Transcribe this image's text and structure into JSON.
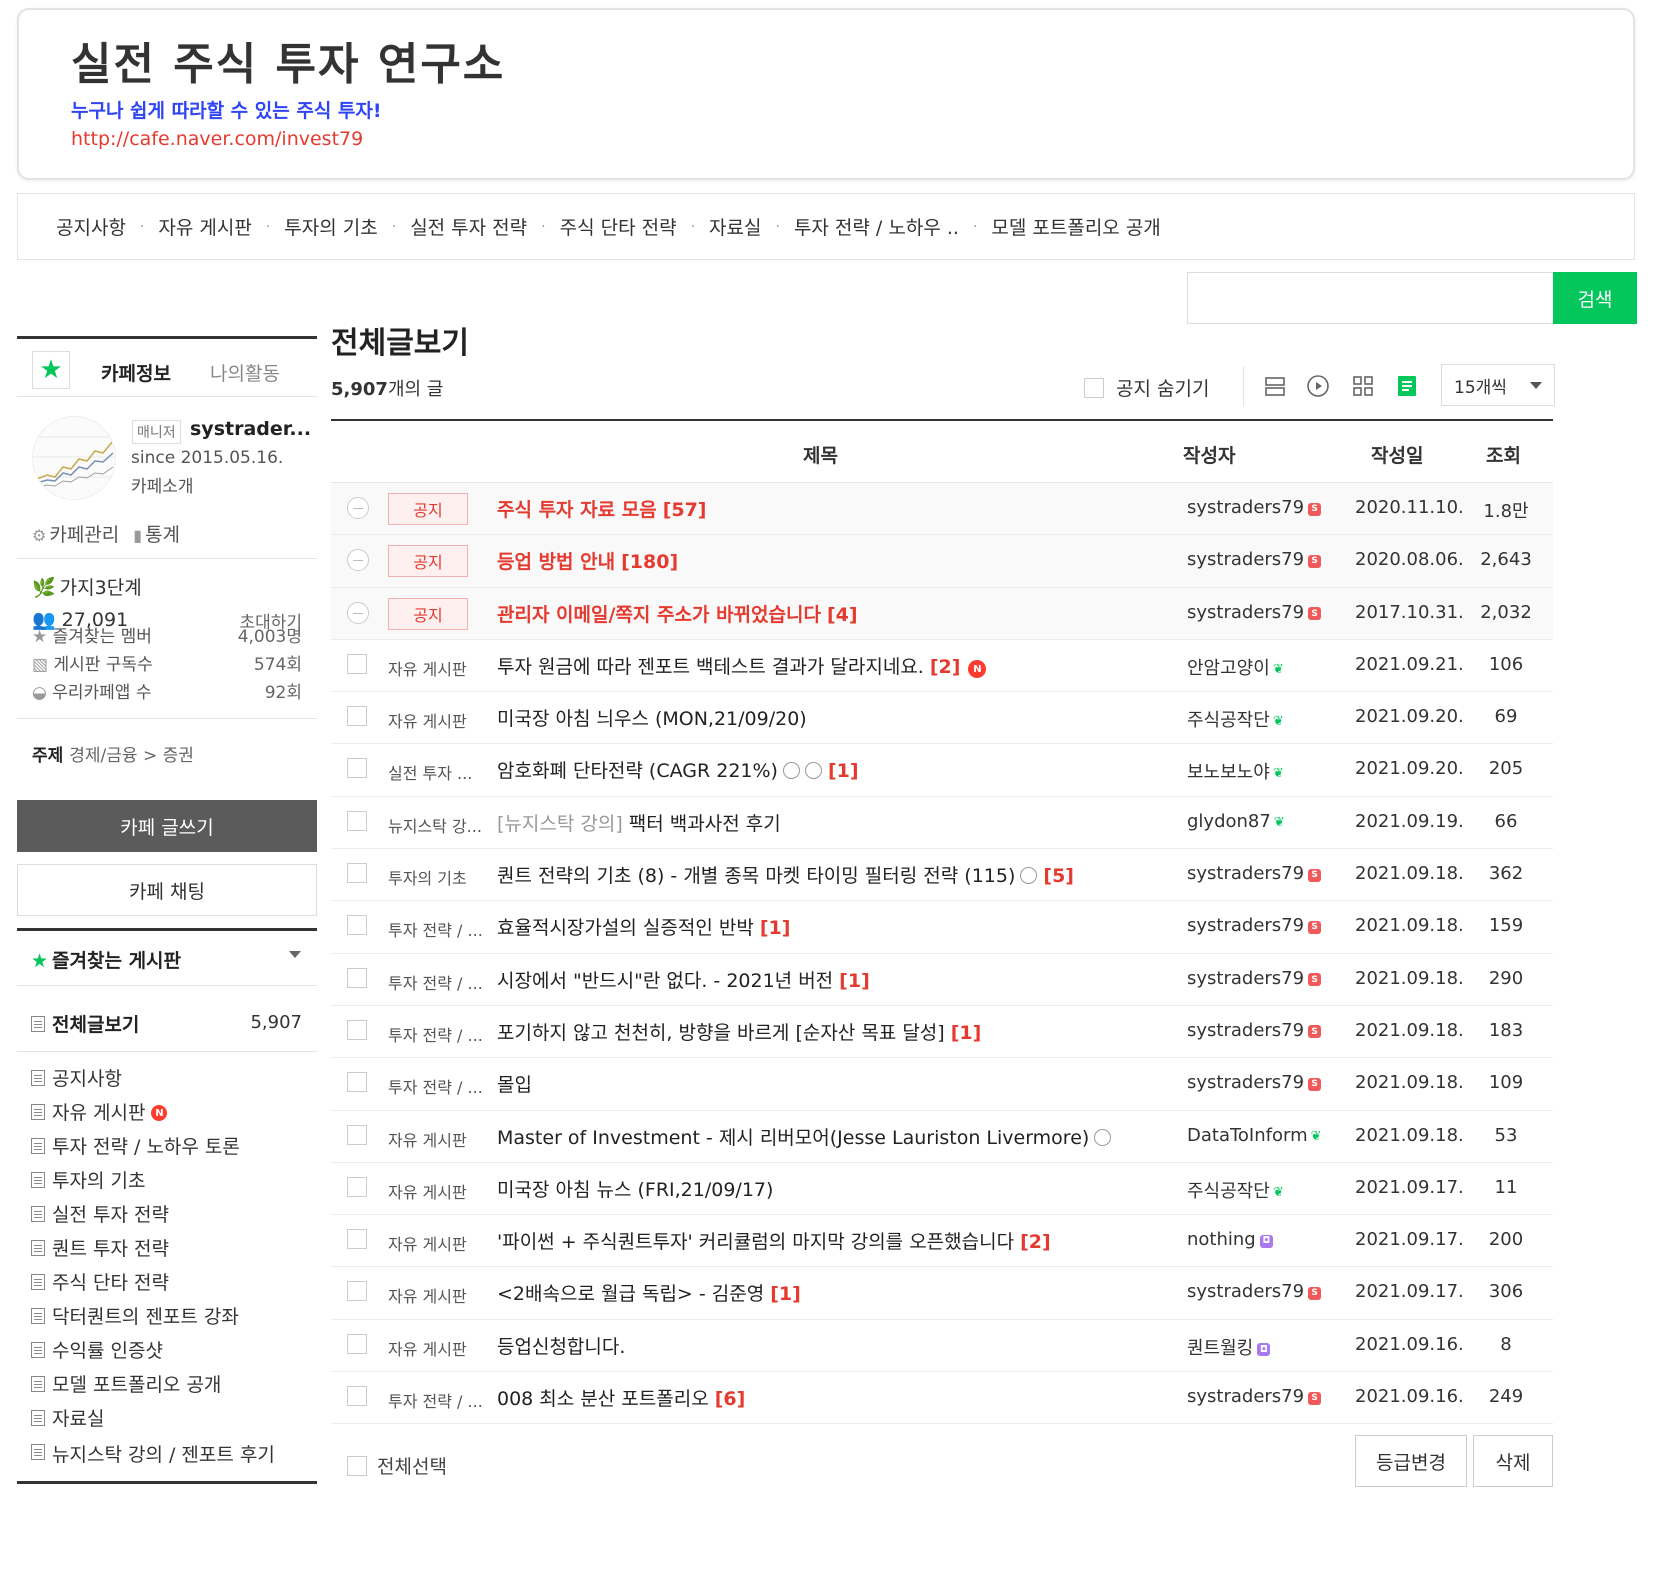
{
  "banner": {
    "title": "실전 주식 투자 연구소",
    "subtitle": "누구나 쉽게 따라할 수 있는 주식 투자!",
    "url": "http://cafe.naver.com/invest79"
  },
  "topmenu": [
    "공지사항",
    "자유 게시판",
    "투자의 기초",
    "실전 투자 전략",
    "주식 단타 전략",
    "자료실",
    "투자 전략 / 노하우 ..",
    "모델 포트폴리오 공개"
  ],
  "search": {
    "button": "검색",
    "value": ""
  },
  "sidebar": {
    "tab_info": "카페정보",
    "tab_activity": "나의활동",
    "manager_badge": "매니저",
    "manager_name": "systrader...",
    "since": "since 2015.05.16.",
    "intro": "카페소개",
    "manage": "카페관리",
    "stats": "통계",
    "level": "가지3단계",
    "members": "27,091",
    "invite": "초대하기",
    "fav_members_label": "즐겨찾는 멤버",
    "fav_members_value": "4,003명",
    "subscribers_label": "게시판 구독수",
    "subscribers_value": "574회",
    "app_label": "우리카페앱 수",
    "app_value": "92회",
    "theme_label": "주제",
    "theme_value": "경제/금융 > 증권",
    "write_button": "카페 글쓰기",
    "chat_button": "카페 채팅",
    "fav_boards": "즐겨찾는 게시판",
    "all_posts": "전체글보기",
    "all_posts_count": "5,907",
    "boards": [
      "공지사항",
      "자유 게시판",
      "투자 전략 / 노하우 토론",
      "투자의 기초",
      "실전 투자 전략",
      "퀀트 투자 전략",
      "주식 단타 전략",
      "닥터퀀트의 젠포트 강좌",
      "수익률 인증샷",
      "모델 포트폴리오 공개",
      "자료실",
      "뉴지스탁 강의 / 젠포트 후기"
    ]
  },
  "main": {
    "title": "전체글보기",
    "count": "5,907",
    "count_suffix": "개의 글",
    "hide_notice": "공지 숨기기",
    "per_page": "15개씩",
    "col_title": "제목",
    "col_author": "작성자",
    "col_date": "작성일",
    "col_views": "조회",
    "notice_tag": "공지",
    "select_all": "전체선택",
    "btn_grade": "등급변경",
    "btn_delete": "삭제"
  },
  "rows": [
    {
      "notice": true,
      "cat": "공지",
      "title": "주식 투자 자료 모음",
      "cmt": "[57]",
      "author": "systraders79",
      "badge": "s",
      "date": "2020.11.10.",
      "views": "1.8만"
    },
    {
      "notice": true,
      "cat": "공지",
      "title": "등업 방법 안내",
      "cmt": "[180]",
      "author": "systraders79",
      "badge": "s",
      "date": "2020.08.06.",
      "views": "2,643"
    },
    {
      "notice": true,
      "cat": "공지",
      "title": "관리자 이메일/쪽지 주소가 바뀌었습니다",
      "cmt": "[4]",
      "author": "systraders79",
      "badge": "s",
      "date": "2017.10.31.",
      "views": "2,032"
    },
    {
      "notice": false,
      "cat": "자유 게시판",
      "title": "투자 원금에 따라 젠포트 백테스트 결과가 달라지네요.",
      "cmt": "[2]",
      "new": "N",
      "author": "안암고양이",
      "badge": "leaf",
      "date": "2021.09.21.",
      "views": "106"
    },
    {
      "notice": false,
      "cat": "자유 게시판",
      "title": "미국장 아침 늬우스 (MON,21/09/20)",
      "cmt": "",
      "author": "주식공작단",
      "badge": "leaf",
      "date": "2021.09.20.",
      "views": "69"
    },
    {
      "notice": false,
      "cat": "실전 투자 ...",
      "title": "암호화폐 단타전략 (CAGR 221%)",
      "icons": 2,
      "cmt": "[1]",
      "author": "보노보노야",
      "badge": "leaf",
      "date": "2021.09.20.",
      "views": "205"
    },
    {
      "notice": false,
      "cat": "뉴지스탁 강...",
      "pre": "[뉴지스탁 강의]",
      "title": " 팩터 백과사전 후기",
      "cmt": "",
      "author": "glydon87",
      "badge": "leaf",
      "date": "2021.09.19.",
      "views": "66"
    },
    {
      "notice": false,
      "cat": "투자의 기초",
      "title": "퀀트 전략의 기초 (8) - 개별 종목 마켓 타이밍 필터링 전략 (115)",
      "icons": 1,
      "cmt": "[5]",
      "author": "systraders79",
      "badge": "s",
      "date": "2021.09.18.",
      "views": "362"
    },
    {
      "notice": false,
      "cat": "투자 전략 / ...",
      "title": "효율적시장가설의 실증적인 반박",
      "cmt": "[1]",
      "author": "systraders79",
      "badge": "s",
      "date": "2021.09.18.",
      "views": "159"
    },
    {
      "notice": false,
      "cat": "투자 전략 / ...",
      "title": "시장에서 \"반드시\"란 없다. - 2021년 버전",
      "cmt": "[1]",
      "author": "systraders79",
      "badge": "s",
      "date": "2021.09.18.",
      "views": "290"
    },
    {
      "notice": false,
      "cat": "투자 전략 / ...",
      "title": "포기하지 않고 천천히, 방향을 바르게 [순자산 목표 달성]",
      "cmt": "[1]",
      "author": "systraders79",
      "badge": "s",
      "date": "2021.09.18.",
      "views": "183"
    },
    {
      "notice": false,
      "cat": "투자 전략 / ...",
      "title": "몰입",
      "cmt": "",
      "author": "systraders79",
      "badge": "s",
      "date": "2021.09.18.",
      "views": "109"
    },
    {
      "notice": false,
      "cat": "자유 게시판",
      "title": "Master of Investment - 제시 리버모어(Jesse Lauriston Livermore)",
      "icons": 1,
      "cmt": "",
      "author": "DataToInform",
      "badge": "leaf",
      "date": "2021.09.18.",
      "views": "53"
    },
    {
      "notice": false,
      "cat": "자유 게시판",
      "title": "미국장 아침 뉴스 (FRI,21/09/17)",
      "cmt": "",
      "author": "주식공작단",
      "badge": "leaf",
      "date": "2021.09.17.",
      "views": "11"
    },
    {
      "notice": false,
      "cat": "자유 게시판",
      "title": "'파이썬 + 주식퀀트투자' 커리큘럼의 마지막 강의를 오픈했습니다",
      "cmt": "[2]",
      "author": "nothing",
      "badge": "p",
      "date": "2021.09.17.",
      "views": "200"
    },
    {
      "notice": false,
      "cat": "자유 게시판",
      "title": "<2배속으로 월급 독립> - 김준영",
      "cmt": "[1]",
      "author": "systraders79",
      "badge": "s",
      "date": "2021.09.17.",
      "views": "306"
    },
    {
      "notice": false,
      "cat": "자유 게시판",
      "title": "등업신청합니다.",
      "cmt": "",
      "author": "퀀트월킹",
      "badge": "p",
      "date": "2021.09.16.",
      "views": "8"
    },
    {
      "notice": false,
      "cat": "투자 전략 / ...",
      "title": "008 최소 분산 포트폴리오",
      "cmt": "[6]",
      "author": "systraders79",
      "badge": "s",
      "date": "2021.09.16.",
      "views": "249"
    }
  ]
}
